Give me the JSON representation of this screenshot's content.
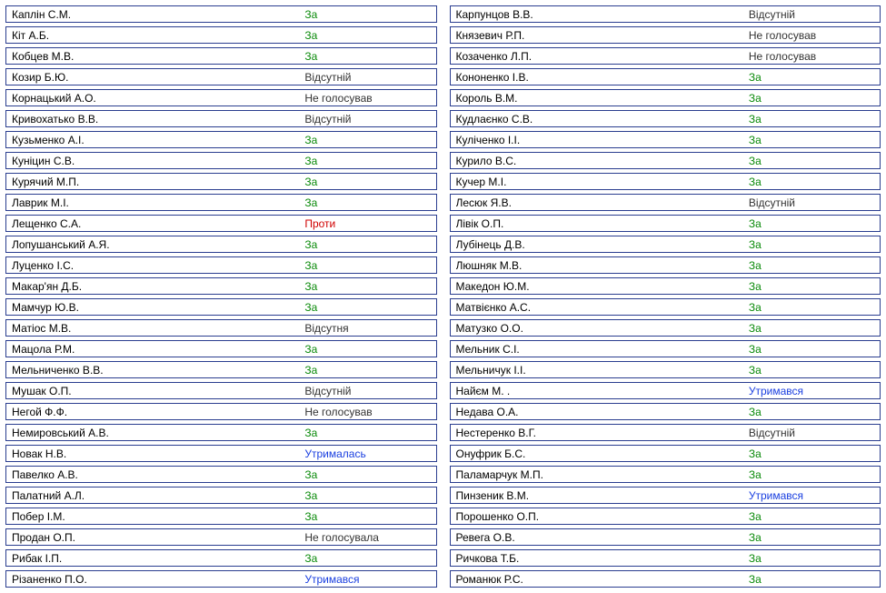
{
  "vote_classes": {
    "За": "v-za",
    "Проти": "v-proty",
    "Відсутній": "v-absent",
    "Відсутня": "v-absent",
    "Не голосував": "v-novote",
    "Не голосувала": "v-novote",
    "Утримався": "v-abstain",
    "Утрималась": "v-abstain"
  },
  "columns": [
    [
      {
        "name": "Каплін С.М.",
        "vote": "За"
      },
      {
        "name": "Кіт А.Б.",
        "vote": "За"
      },
      {
        "name": "Кобцев М.В.",
        "vote": "За"
      },
      {
        "name": "Козир Б.Ю.",
        "vote": "Відсутній"
      },
      {
        "name": "Корнацький А.О.",
        "vote": "Не голосував"
      },
      {
        "name": "Кривохатько В.В.",
        "vote": "Відсутній"
      },
      {
        "name": "Кузьменко А.І.",
        "vote": "За"
      },
      {
        "name": "Куніцин С.В.",
        "vote": "За"
      },
      {
        "name": "Курячий М.П.",
        "vote": "За"
      },
      {
        "name": "Лаврик М.І.",
        "vote": "За"
      },
      {
        "name": "Лещенко С.А.",
        "vote": "Проти"
      },
      {
        "name": "Лопушанський А.Я.",
        "vote": "За"
      },
      {
        "name": "Луценко І.С.",
        "vote": "За"
      },
      {
        "name": "Макар'ян Д.Б.",
        "vote": "За"
      },
      {
        "name": "Мамчур Ю.В.",
        "vote": "За"
      },
      {
        "name": "Матіос М.В.",
        "vote": "Відсутня"
      },
      {
        "name": "Мацола Р.М.",
        "vote": "За"
      },
      {
        "name": "Мельниченко В.В.",
        "vote": "За"
      },
      {
        "name": "Мушак О.П.",
        "vote": "Відсутній"
      },
      {
        "name": "Негой Ф.Ф.",
        "vote": "Не голосував"
      },
      {
        "name": "Немировський А.В.",
        "vote": "За"
      },
      {
        "name": "Новак Н.В.",
        "vote": "Утрималась"
      },
      {
        "name": "Павелко А.В.",
        "vote": "За"
      },
      {
        "name": "Палатний А.Л.",
        "vote": "За"
      },
      {
        "name": "Побер І.М.",
        "vote": "За"
      },
      {
        "name": "Продан О.П.",
        "vote": "Не голосувала"
      },
      {
        "name": "Рибак І.П.",
        "vote": "За"
      },
      {
        "name": "Різаненко П.О.",
        "vote": "Утримався"
      }
    ],
    [
      {
        "name": "Карпунцов В.В.",
        "vote": "Відсутній"
      },
      {
        "name": "Князевич Р.П.",
        "vote": "Не голосував"
      },
      {
        "name": "Козаченко Л.П.",
        "vote": "Не голосував"
      },
      {
        "name": "Кононенко І.В.",
        "vote": "За"
      },
      {
        "name": "Король В.М.",
        "vote": "За"
      },
      {
        "name": "Кудлаєнко С.В.",
        "vote": "За"
      },
      {
        "name": "Куліченко І.І.",
        "vote": "За"
      },
      {
        "name": "Курило В.С.",
        "vote": "За"
      },
      {
        "name": "Кучер М.І.",
        "vote": "За"
      },
      {
        "name": "Лесюк Я.В.",
        "vote": "Відсутній"
      },
      {
        "name": "Лівік О.П.",
        "vote": "За"
      },
      {
        "name": "Лубінець Д.В.",
        "vote": "За"
      },
      {
        "name": "Люшняк М.В.",
        "vote": "За"
      },
      {
        "name": "Македон Ю.М.",
        "vote": "За"
      },
      {
        "name": "Матвієнко А.С.",
        "vote": "За"
      },
      {
        "name": "Матузко О.О.",
        "vote": "За"
      },
      {
        "name": "Мельник С.І.",
        "vote": "За"
      },
      {
        "name": "Мельничук І.І.",
        "vote": "За"
      },
      {
        "name": "Найєм М. .",
        "vote": "Утримався"
      },
      {
        "name": "Недава О.А.",
        "vote": "За"
      },
      {
        "name": "Нестеренко В.Г.",
        "vote": "Відсутній"
      },
      {
        "name": "Онуфрик Б.С.",
        "vote": "За"
      },
      {
        "name": "Паламарчук М.П.",
        "vote": "За"
      },
      {
        "name": "Пинзеник В.М.",
        "vote": "Утримався"
      },
      {
        "name": "Порошенко О.П.",
        "vote": "За"
      },
      {
        "name": "Ревега О.В.",
        "vote": "За"
      },
      {
        "name": "Ричкова Т.Б.",
        "vote": "За"
      },
      {
        "name": "Романюк Р.С.",
        "vote": "За"
      }
    ]
  ]
}
